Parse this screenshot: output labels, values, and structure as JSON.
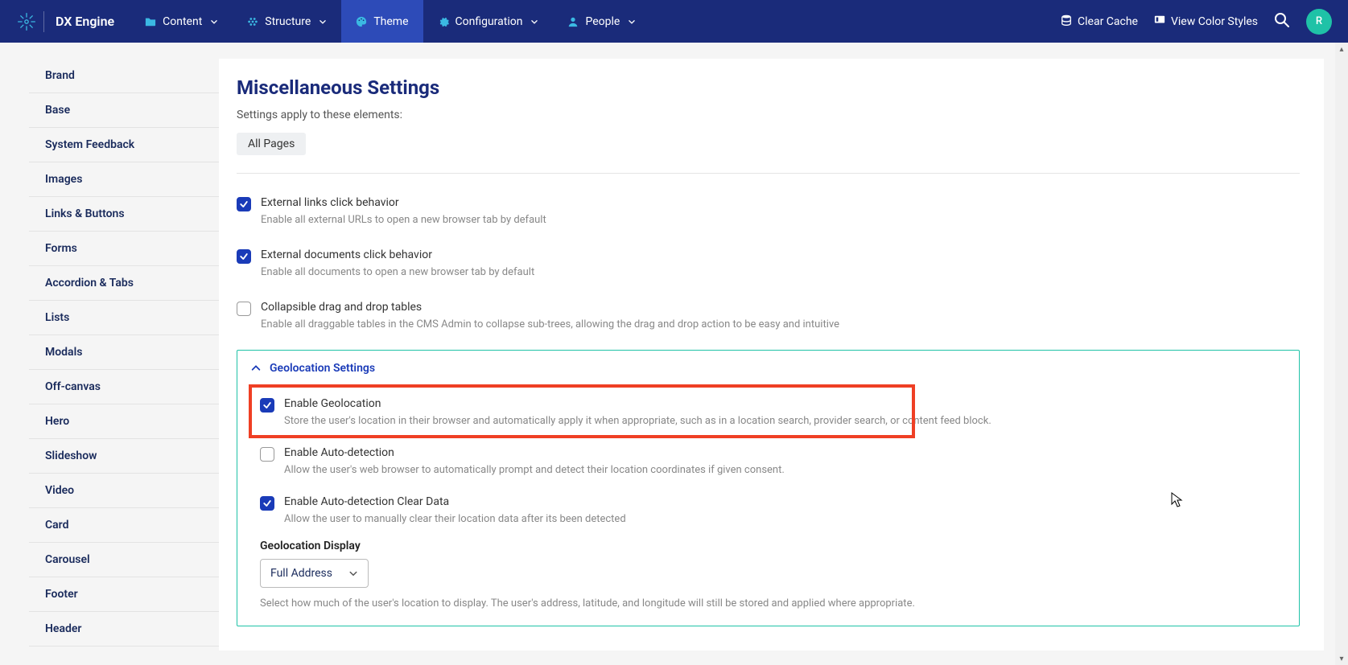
{
  "brand": {
    "name": "DX Engine"
  },
  "nav": {
    "items": [
      {
        "label": "Content",
        "icon": "folder",
        "chevron": true
      },
      {
        "label": "Structure",
        "icon": "dots",
        "chevron": true
      },
      {
        "label": "Theme",
        "icon": "palette",
        "chevron": false,
        "active": true
      },
      {
        "label": "Configuration",
        "icon": "gear",
        "chevron": true
      },
      {
        "label": "People",
        "icon": "user",
        "chevron": true
      }
    ]
  },
  "nav_right": {
    "clear_cache": "Clear Cache",
    "view_color_styles": "View Color Styles",
    "avatar_initial": "R"
  },
  "sidebar": {
    "items": [
      "Brand",
      "Base",
      "System Feedback",
      "Images",
      "Links & Buttons",
      "Forms",
      "Accordion & Tabs",
      "Lists",
      "Modals",
      "Off-canvas",
      "Hero",
      "Slideshow",
      "Video",
      "Card",
      "Carousel",
      "Footer",
      "Header"
    ]
  },
  "main": {
    "title": "Miscellaneous Settings",
    "subtitle": "Settings apply to these elements:",
    "chip": "All Pages",
    "settings": [
      {
        "checked": true,
        "label": "External links click behavior",
        "desc": "Enable all external URLs to open a new browser tab by default"
      },
      {
        "checked": true,
        "label": "External documents click behavior",
        "desc": "Enable all documents to open a new browser tab by default"
      },
      {
        "checked": false,
        "label": "Collapsible drag and drop tables",
        "desc": "Enable all draggable tables in the CMS Admin to collapse sub-trees, allowing the drag and drop action to be easy and intuitive"
      }
    ],
    "geo": {
      "title": "Geolocation Settings",
      "items": [
        {
          "checked": true,
          "label": "Enable Geolocation",
          "desc": "Store the user's location in their browser and automatically apply it when appropriate, such as in a location search, provider search, or content feed block."
        },
        {
          "checked": false,
          "label": "Enable Auto-detection",
          "desc": "Allow the user's web browser to automatically prompt and detect their location coordinates if given consent."
        },
        {
          "checked": true,
          "label": "Enable Auto-detection Clear Data",
          "desc": "Allow the user to manually clear their location data after its been detected"
        }
      ],
      "display_field": {
        "label": "Geolocation Display",
        "value": "Full Address",
        "desc": "Select how much of the user's location to display. The user's address, latitude, and longitude will still be stored and applied where appropriate."
      }
    }
  }
}
